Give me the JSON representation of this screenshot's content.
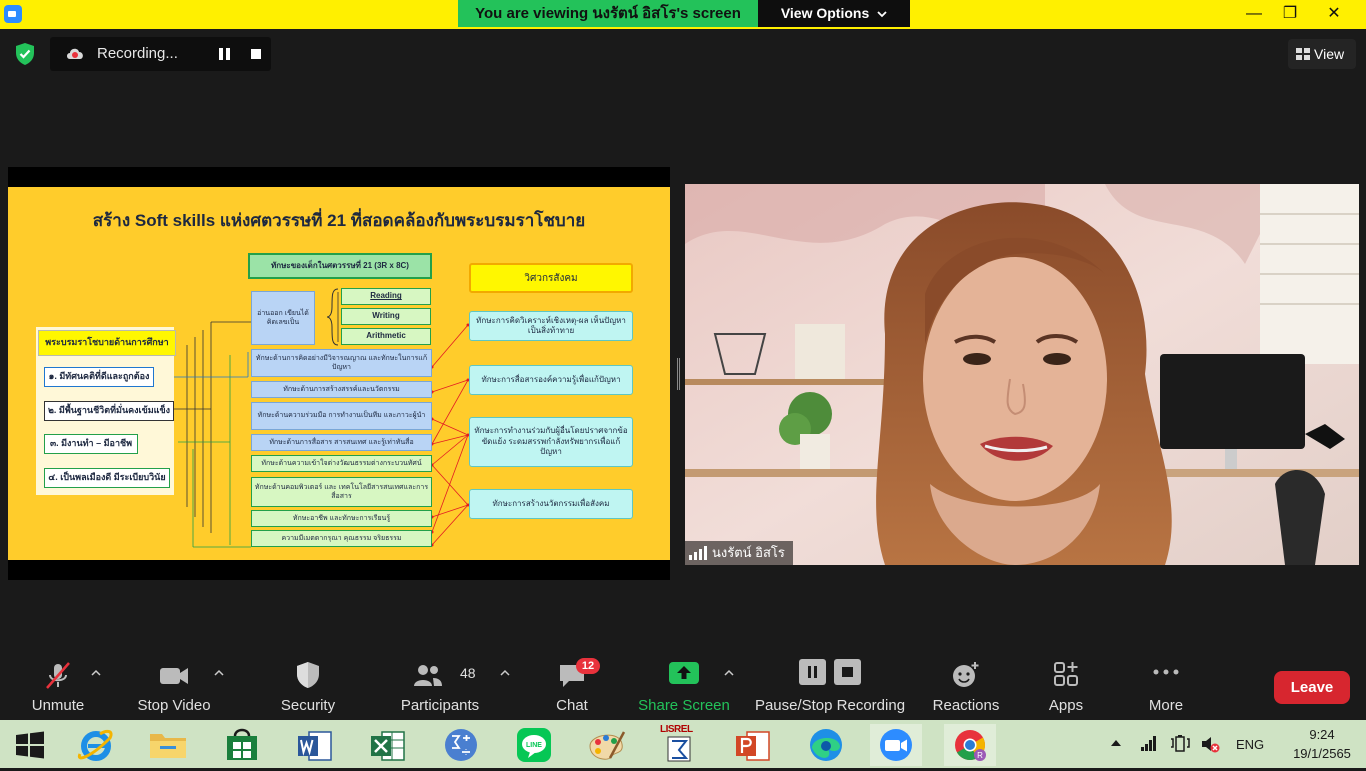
{
  "banner": {
    "viewing_text": "You are viewing นงรัตน์ อิสโร's screen",
    "view_options": "View Options",
    "view_options_icon": "chevron-down-icon"
  },
  "window_controls": {
    "minimize": "—",
    "restore": "❐",
    "close": "✕"
  },
  "recording": {
    "label": "Recording...",
    "pause_icon": "pause-icon",
    "stop_icon": "stop-icon"
  },
  "view_button": {
    "label": "View"
  },
  "slide": {
    "title": "สร้าง Soft skills แห่งศตวรรษที่ 21 ที่สอดคล้องกับพระบรมราโชบาย",
    "policy_header": "พระบรมราโชบายด้านการศึกษา",
    "policy_items": [
      "๑. มีทัศนคติที่ดีและถูกต้อง",
      "๒. มีพื้นฐานชีวิตที่มั่นคงเข้มแข็ง",
      "๓. มีงานทำ – มีอาชีพ",
      "๔. เป็นพลเมืองดี มีระเบียบวินัย"
    ],
    "skills_header": "ทักษะของเด็กในศตวรรษที่ 21 (3R x 8C)",
    "three_r_group": "อ่านออก เขียนได้ คิดเลขเป็น",
    "three_r": [
      "Reading",
      "Writing",
      "Arithmetic"
    ],
    "eight_c": [
      "ทักษะด้านการคิดอย่างมีวิจารณญาณ และทักษะในการแก้ปัญหา",
      "ทักษะด้านการสร้างสรรค์และนวัตกรรม",
      "ทักษะด้านความร่วมมือ การทำงานเป็นทีม และภาวะผู้นำ",
      "ทักษะด้านการสื่อสาร สารสนเทศ และรู้เท่าทันสื่อ",
      "ทักษะด้านความเข้าใจต่างวัฒนธรรมต่างกระบวนทัศน์",
      "ทักษะด้านคอมพิวเตอร์ และ เทคโนโลยีสารสนเทศและการสื่อสาร",
      "ทักษะอาชีพ และทักษะการเรียนรู้",
      "ความมีเมตตากรุณา คุณธรรม จริยธรรม"
    ],
    "social_header": "วิศวกรสังคม",
    "social_items": [
      "ทักษะการคิดวิเคราะห์เชิงเหตุ-ผล เห็นปัญหาเป็นสิ่งท้าทาย",
      "ทักษะการสื่อสารองค์ความรู้เพื่อแก้ปัญหา",
      "ทักษะการทำงานร่วมกับผู้อื่นโดยปราศจากข้อขัดแย้ง ระดมสรรพกำลังทรัพยากรเพื่อแก้ปัญหา",
      "ทักษะการสร้างนวัตกรรมเพื่อสังคม"
    ]
  },
  "participant": {
    "name": "นงรัตน์ อิสโร"
  },
  "toolbar": {
    "unmute": "Unmute",
    "stop_video": "Stop Video",
    "security": "Security",
    "participants": "Participants",
    "participants_count": "48",
    "chat": "Chat",
    "chat_badge": "12",
    "share_screen": "Share Screen",
    "pause_stop_recording": "Pause/Stop Recording",
    "reactions": "Reactions",
    "apps": "Apps",
    "more": "More",
    "leave": "Leave"
  },
  "colors": {
    "banner_green": "#23c25a",
    "title_yellow": "#fff000",
    "share_green": "#23c25a",
    "leave_red": "#d7262f",
    "chat_badge": "#e8323c",
    "slide_yellow": "#ffcc2b"
  },
  "taskbar": {
    "apps": [
      "windows-start-icon",
      "internet-explorer-icon",
      "file-explorer-icon",
      "microsoft-store-icon",
      "word-icon",
      "excel-icon",
      "math-input-icon",
      "line-icon",
      "paint-icon",
      "lisrel-icon",
      "powerpoint-icon",
      "edge-icon",
      "zoom-icon",
      "chrome-icon"
    ],
    "lisrel_label": "LISREL",
    "language": "ENG",
    "time": "9:24",
    "date": "19/1/2565"
  }
}
